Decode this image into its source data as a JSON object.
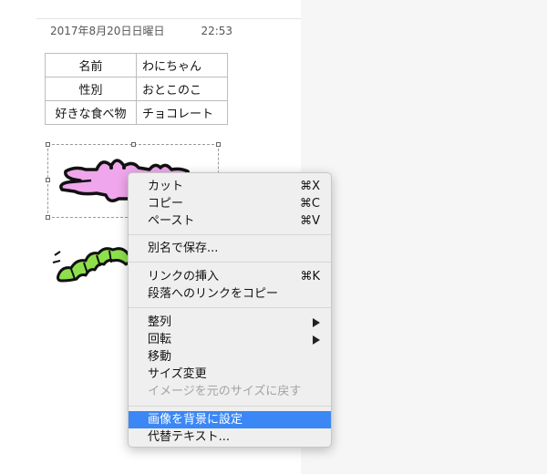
{
  "document": {
    "date": "2017年8月20日日曜日",
    "time": "22:53",
    "table": [
      {
        "key": "名前",
        "value": "わにちゃん"
      },
      {
        "key": "性別",
        "value": "おとこのこ"
      },
      {
        "key": "好きな食べ物",
        "value": "チョコレート"
      }
    ],
    "images": [
      "crocodile-illustration",
      "caterpillar-illustration"
    ]
  },
  "context_menu": {
    "items": [
      {
        "label": "カット",
        "shortcut": "⌘X"
      },
      {
        "label": "コピー",
        "shortcut": "⌘C"
      },
      {
        "label": "ペースト",
        "shortcut": "⌘V"
      },
      {
        "label": "別名で保存..."
      },
      {
        "label": "リンクの挿入",
        "shortcut": "⌘K"
      },
      {
        "label": "段落へのリンクをコピー"
      },
      {
        "label": "整列",
        "submenu": true
      },
      {
        "label": "回転",
        "submenu": true
      },
      {
        "label": "移動"
      },
      {
        "label": "サイズ変更"
      },
      {
        "label": "イメージを元のサイズに戻す",
        "disabled": true
      },
      {
        "label": "画像を背景に設定",
        "highlighted": true
      },
      {
        "label": "代替テキスト..."
      }
    ]
  },
  "colors": {
    "highlight": "#3b87f5",
    "crocodile": "#f0a6ec",
    "caterpillar": "#8de04b"
  }
}
